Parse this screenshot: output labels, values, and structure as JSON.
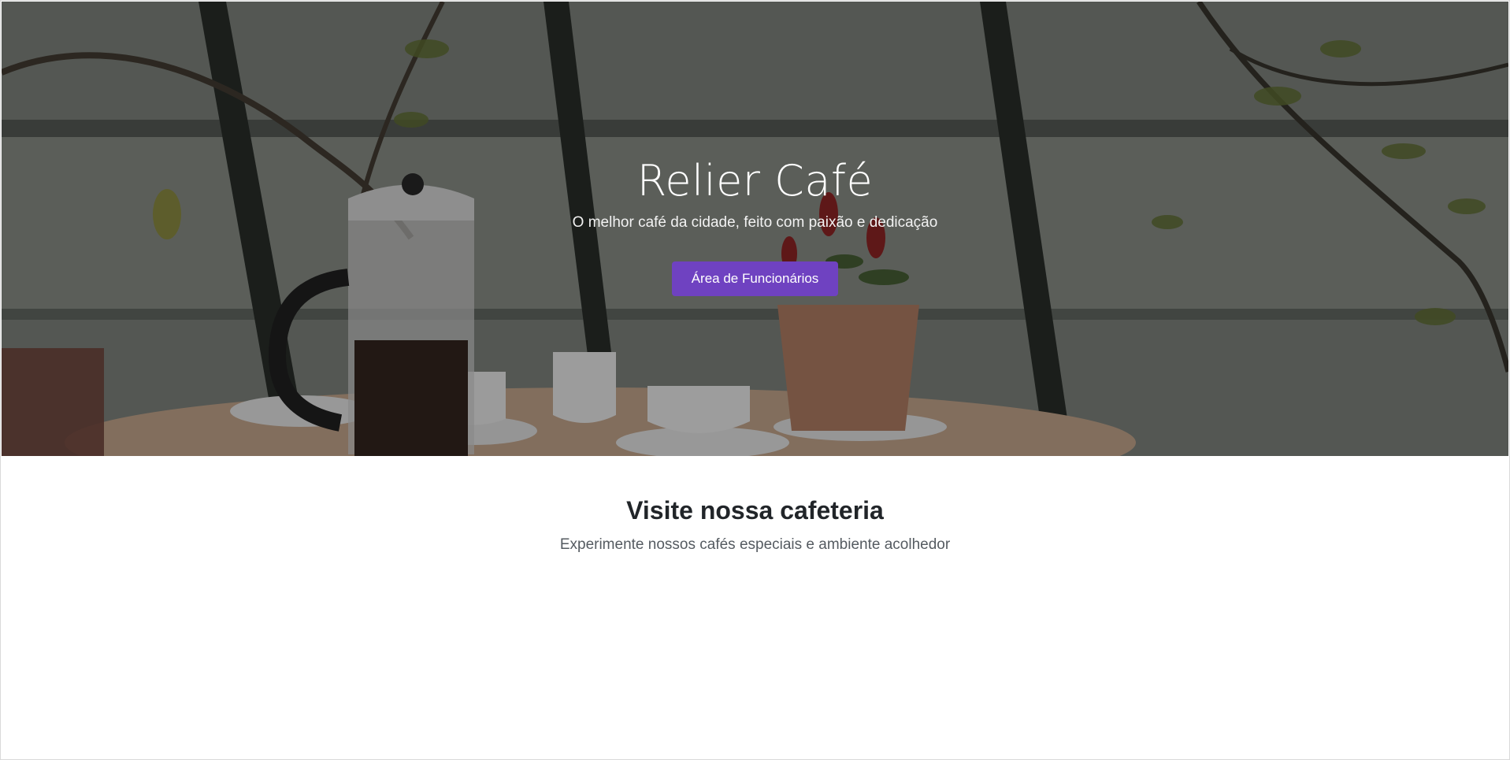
{
  "hero": {
    "title": "Relier Café",
    "subtitle": "O melhor café da cidade, feito com paixão e dedicação",
    "button_label": "Área de Funcionários",
    "background_image": "cafe-table-with-french-press-photo"
  },
  "visit_section": {
    "title": "Visite nossa cafeteria",
    "subtitle": "Experimente nossos cafés especiais e ambiente acolhedor"
  },
  "colors": {
    "accent": "#6f42c1",
    "heading": "#212529",
    "muted_text": "#555b61"
  }
}
